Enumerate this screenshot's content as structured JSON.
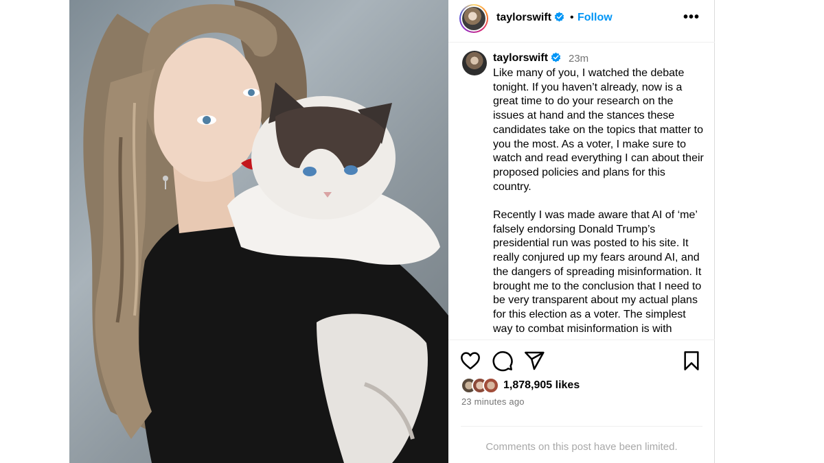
{
  "post": {
    "username": "taylorswift",
    "follow_label": "Follow",
    "separator": "•",
    "more_label": "•••",
    "caption_time": "23m",
    "caption": "Like many of you, I watched the debate tonight. If you haven’t already, now is a great time to do your research on the issues at hand and the stances these candidates take on the topics that matter to you the most. As a voter, I make sure to watch and read everything I can about their proposed policies and plans for this country.\n\nRecently I was made aware that AI of ‘me’ falsely endorsing Donald Trump’s presidential run was posted to his site. It really conjured up my fears around AI, and the dangers of spreading misinformation. It brought me to the conclusion that I need to be very transparent about my actual plans for this election as a voter. The simplest way to combat misinformation is with",
    "likes": "1,878,905 likes",
    "posted_ago": "23 minutes ago",
    "comments_notice": "Comments on this post have been limited."
  },
  "icons": {
    "verified": "verified-badge-icon",
    "like": "heart-icon",
    "comment": "comment-icon",
    "share": "share-icon",
    "save": "bookmark-icon"
  },
  "colors": {
    "follow": "#0095f6",
    "verified": "#0095f6",
    "muted": "#737373"
  }
}
